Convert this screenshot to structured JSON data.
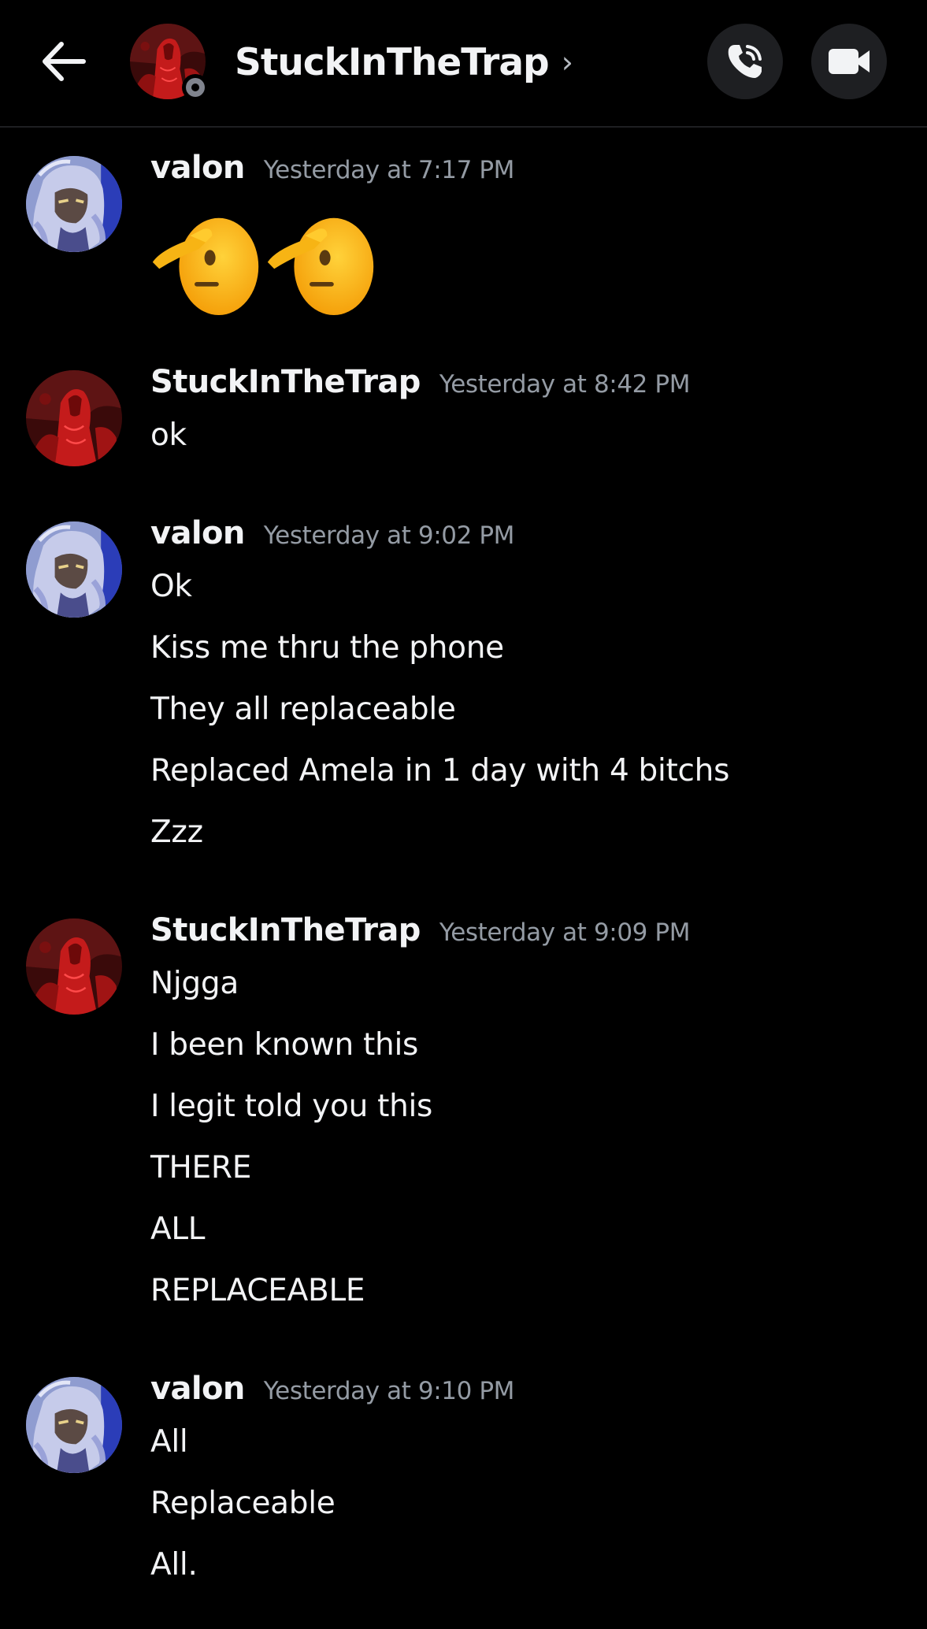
{
  "header": {
    "title": "StuckInTheTrap",
    "chevron": "›",
    "back_icon": "arrow-left-icon",
    "call_icon": "phone-call-icon",
    "video_icon": "video-camera-icon"
  },
  "users": {
    "valon": {
      "name": "valon",
      "avatar": "anime-character-avatar"
    },
    "stuck": {
      "name": "StuckInTheTrap",
      "avatar": "red-hooded-figure-avatar"
    }
  },
  "messages": [
    {
      "author": "valon",
      "timestamp": "Yesterday at 7:17 PM",
      "emojis": [
        "saluting-face",
        "saluting-face"
      ],
      "lines": []
    },
    {
      "author": "StuckInTheTrap",
      "timestamp": "Yesterday at 8:42 PM",
      "lines": [
        "ok"
      ]
    },
    {
      "author": "valon",
      "timestamp": "Yesterday at 9:02 PM",
      "lines": [
        "Ok",
        "Kiss me thru the phone",
        "They all replaceable",
        "Replaced Amela in 1 day with 4 bitchs",
        "Zzz"
      ]
    },
    {
      "author": "StuckInTheTrap",
      "timestamp": "Yesterday at 9:09 PM",
      "lines": [
        "Njgga",
        "I been known this",
        "I legit told you this",
        "THERE",
        "ALL",
        "REPLACEABLE"
      ]
    },
    {
      "author": "valon",
      "timestamp": "Yesterday at 9:10 PM",
      "lines": [
        "All",
        "Replaceable",
        "All."
      ]
    }
  ],
  "colors": {
    "background": "#000000",
    "text": "#f2f3f5",
    "muted": "#949ba4",
    "button_bg": "#1e1f22"
  }
}
